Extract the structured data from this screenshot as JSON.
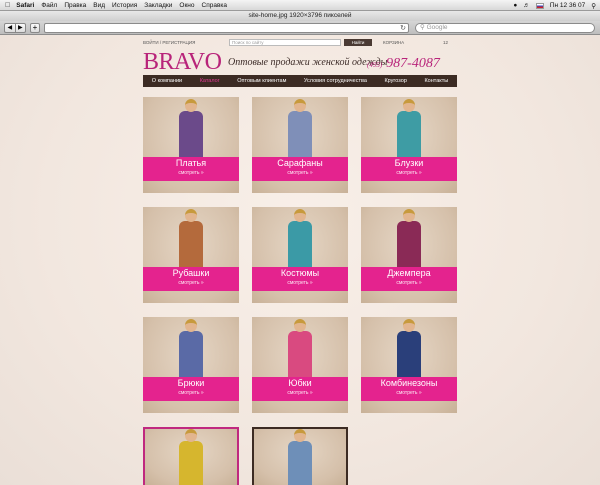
{
  "menubar": {
    "app": "Safari",
    "items": [
      "Файл",
      "Правка",
      "Вид",
      "История",
      "Закладки",
      "Окно",
      "Справка"
    ],
    "clock": "Пн 12 36 07"
  },
  "window": {
    "title": "site-home.jpg 1920×3796 пикселей",
    "search_placeholder": "Google"
  },
  "site": {
    "login": "ВОЙТИ / РЕГИСТРАЦИЯ",
    "search_placeholder": "Поиск по сайту",
    "search_button": "Найти",
    "cart_label": "КОРЗИНА",
    "cart_count": "12",
    "logo": "BRAVO",
    "tagline": "Оптовые продажи женской одежды",
    "phone_code": "(495)",
    "phone_number": "987-4087",
    "nav": [
      {
        "label": "О компании",
        "active": false
      },
      {
        "label": "Каталог",
        "active": true
      },
      {
        "label": "Оптовым клиентам",
        "active": false
      },
      {
        "label": "Условия сотрудничества",
        "active": false
      },
      {
        "label": "Кругозор",
        "active": false
      },
      {
        "label": "Контакты",
        "active": false
      }
    ]
  },
  "catalog": {
    "cta": "смотреть »",
    "categories": [
      {
        "name": "Платья",
        "color": "#6b4a8a"
      },
      {
        "name": "Сарафаны",
        "color": "#7f8fb8"
      },
      {
        "name": "Блузки",
        "color": "#3e9ca4"
      },
      {
        "name": "Рубашки",
        "color": "#b46a3c"
      },
      {
        "name": "Костюмы",
        "color": "#3b9aa6"
      },
      {
        "name": "Джемпера",
        "color": "#8a2a56"
      },
      {
        "name": "Брюки",
        "color": "#5a6aa6"
      },
      {
        "name": "Юбки",
        "color": "#d94a80"
      },
      {
        "name": "Комбинезоны",
        "color": "#2a3f7a"
      }
    ],
    "extra": [
      {
        "color": "#d6b62e"
      },
      {
        "color": "#6e8fb8"
      }
    ]
  }
}
